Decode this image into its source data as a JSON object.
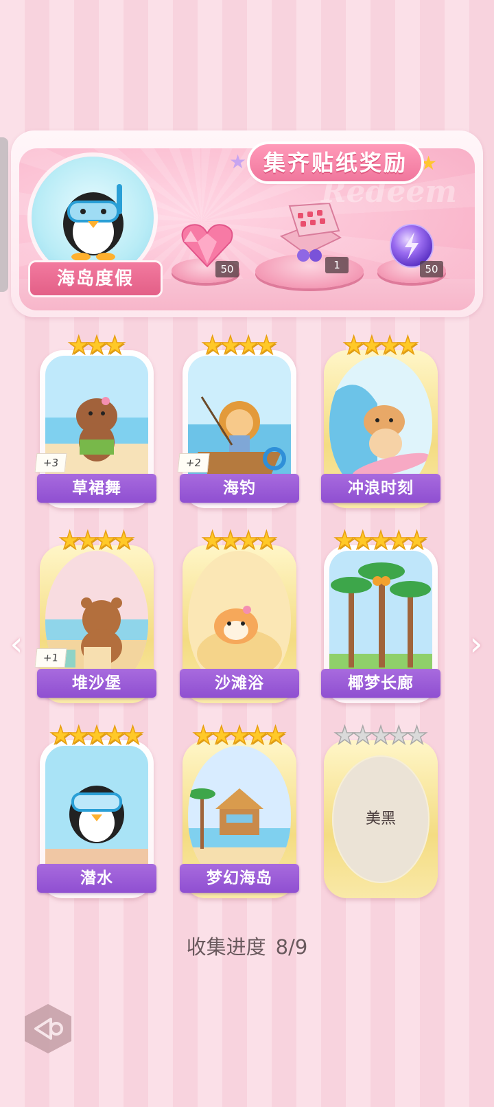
{
  "banner": {
    "title": "集齐贴纸奖励",
    "watermark": "Redeem",
    "theme": "海岛度假",
    "rewards": [
      {
        "icon": "pink-heart-gem-icon",
        "count": "50"
      },
      {
        "icon": "gift-box-icon",
        "count": "1"
      },
      {
        "icon": "purple-energy-orb-icon",
        "count": "50"
      }
    ]
  },
  "cards": [
    {
      "name": "草裙舞",
      "stars": 3,
      "bonus": "+3"
    },
    {
      "name": "海钓",
      "stars": 4,
      "bonus": "+2"
    },
    {
      "name": "冲浪时刻",
      "stars": 4
    },
    {
      "name": "堆沙堡",
      "stars": 4,
      "bonus": "+1"
    },
    {
      "name": "沙滩浴",
      "stars": 4
    },
    {
      "name": "椰梦长廊",
      "stars": 5
    },
    {
      "name": "潜水",
      "stars": 5
    },
    {
      "name": "梦幻海岛",
      "stars": 5
    },
    {
      "name": "美黑",
      "stars": 5,
      "locked": true
    }
  ],
  "progress": {
    "label": "收集进度",
    "value": "8/9"
  },
  "nav": {
    "prev": "‹",
    "next": "›"
  },
  "colors": {
    "label_purple": "#9458d4",
    "theme_pink": "#e8678f",
    "star_gold": "#ffc928"
  }
}
